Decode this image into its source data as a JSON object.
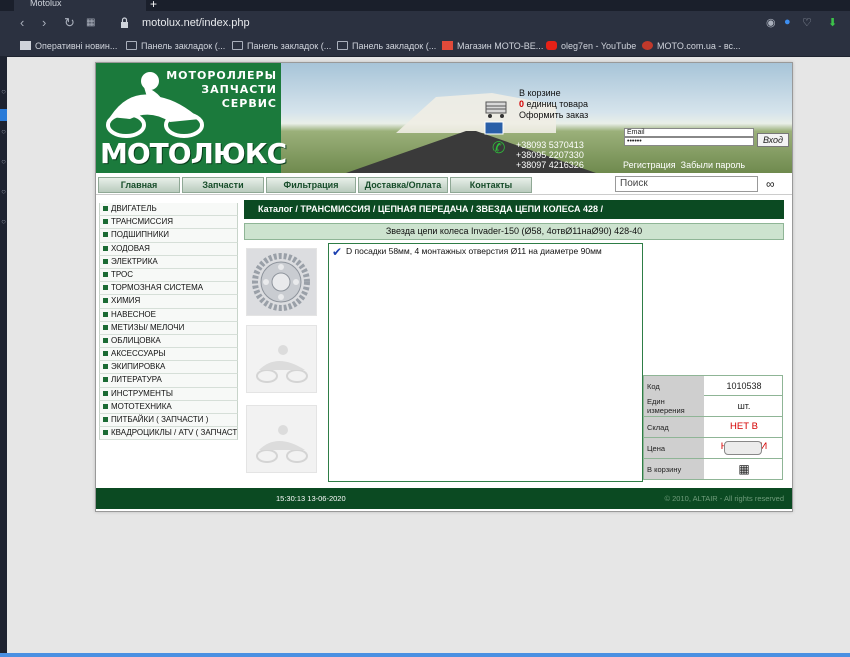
{
  "browser": {
    "tab_title": "Motolux",
    "new_tab": "+",
    "url": "motolux.net/index.php",
    "bookmarks": [
      {
        "icon": "newspaper-icon",
        "label": "Оперативні новин..."
      },
      {
        "icon": "folder-icon",
        "label": "Панель закладок (..."
      },
      {
        "icon": "folder-icon",
        "label": "Панель закладок (..."
      },
      {
        "icon": "folder-icon",
        "label": "Панель закладок (..."
      },
      {
        "icon": "shop-icon",
        "label": "Магазин МОТО-ВЕ..."
      },
      {
        "icon": "youtube-icon",
        "label": "oleg7en - YouTube"
      },
      {
        "icon": "moto-icon",
        "label": "MOTO.com.ua - вс..."
      }
    ]
  },
  "header": {
    "tagline": [
      "МОТОРОЛЛЕРЫ",
      "ЗАПЧАСТИ",
      "СЕРВИС"
    ],
    "logo_text": "МОТОЛЮКС",
    "cart_line1": "В корзине",
    "cart_count": "0",
    "cart_line2": " единиц товара",
    "cart_line3": "Оформить заказ",
    "phones": [
      "+38093 5370413",
      "+38095 2207330",
      "+38097 4216326"
    ],
    "email_label": "Email",
    "password_value": "••••••",
    "login_button": "Вход",
    "register_link": "Регистрация",
    "forgot_link": "Забыли пароль"
  },
  "menu": {
    "items": [
      "Главная",
      "Запчасти",
      "Фильтрация",
      "Доставка/Оплата",
      "Контакты"
    ],
    "search_placeholder": "Поиск"
  },
  "sidebar": {
    "items": [
      "ДВИГАТЕЛЬ",
      "ТРАНСМИССИЯ",
      "ПОДШИПНИКИ",
      "ХОДОВАЯ",
      "ЭЛЕКТРИКА",
      "ТРОС",
      "ТОРМОЗНАЯ СИСТЕМА",
      "ХИМИЯ",
      "НАВЕСНОЕ",
      "МЕТИЗЫ/ МЕЛОЧИ",
      "ОБЛИЦОВКА",
      "АКСЕССУАРЫ",
      "ЭКИПИРОВКА",
      "ЛИТЕРАТУРА",
      "ИНСТРУМЕНТЫ",
      "МОТОТЕХНИКА",
      "ПИТБАЙКИ ( ЗАПЧАСТИ )",
      "КВАДРОЦИКЛЫ / ATV ( ЗАПЧАСТИ )"
    ]
  },
  "content": {
    "breadcrumb": "Каталог /  ТРАНСМИССИЯ /  ЦЕПНАЯ ПЕРЕДАЧА /  ЗВЕЗДА ЦЕПИ КОЛЕСА 428 /",
    "product_title": "Звезда цепи колеса Invader-150 (Ø58, 4отвØ11наØ90) 428-40",
    "description": "D посадки 58мм, 4 монтажных отверстия Ø11 на диаметре 90мм",
    "props": [
      {
        "key": "Код",
        "value": "1010538"
      },
      {
        "key": "Един измерения",
        "value": "шт."
      },
      {
        "key": "Склад",
        "value": "НЕТ В НАЛИЧИИ"
      },
      {
        "key": "Цена",
        "value": ""
      },
      {
        "key": "В корзину",
        "value": ""
      }
    ]
  },
  "footer": {
    "time": "15:30:13 13-06-2020",
    "copyright": "© 2010, ALTAIR - All rights reserved"
  },
  "colors": {
    "brand_green": "#0b4a22",
    "logo_green": "#1b7a3c",
    "stock_red": "#d40000"
  }
}
